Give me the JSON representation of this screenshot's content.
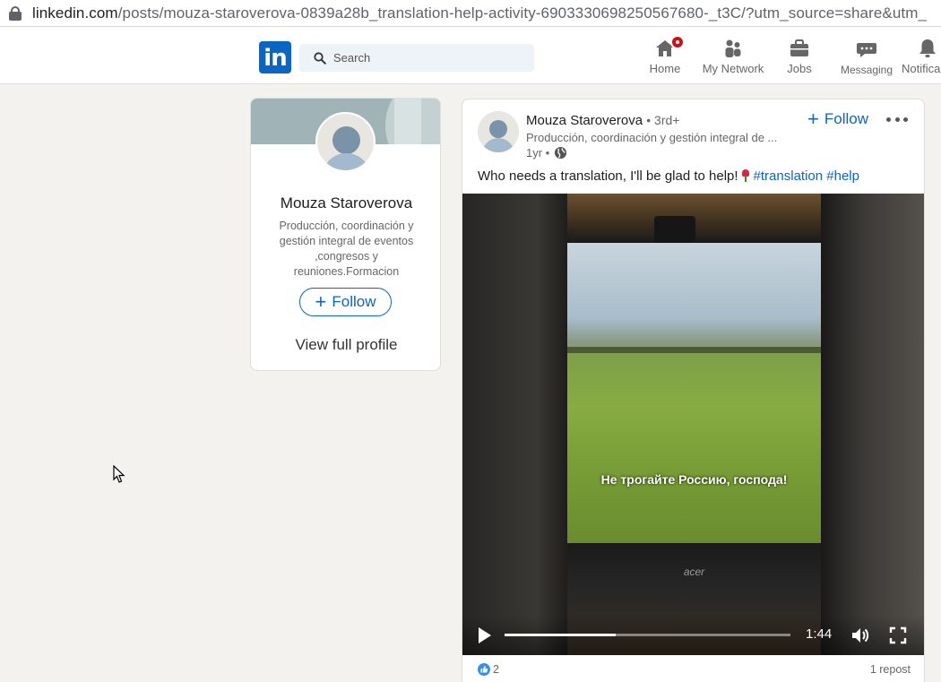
{
  "browser": {
    "url_host": "linkedin.com",
    "url_path": "/posts/mouza-staroverova-0839a28b_translation-help-activity-6903330698250567680-_t3C/?utm_source=share&utm_"
  },
  "nav": {
    "logo": "in",
    "search_placeholder": "Search",
    "items": [
      {
        "label": "Home",
        "icon": "home-icon"
      },
      {
        "label": "My Network",
        "icon": "network-icon"
      },
      {
        "label": "Jobs",
        "icon": "briefcase-icon"
      },
      {
        "label": "Messaging",
        "icon": "messaging-icon"
      },
      {
        "label": "Notifica",
        "icon": "bell-icon"
      }
    ]
  },
  "profile_card": {
    "name": "Mouza Staroverova",
    "headline": "Producción, coordinación y gestión integral de eventos ,congresos y reuniones.Formacion",
    "follow_label": "Follow",
    "view_profile_label": "View full profile"
  },
  "post": {
    "author": "Mouza Staroverova",
    "degree": "• 3rd+",
    "headline": "Producción, coordinación y gestión integral de ...",
    "time": "1yr •",
    "follow_label": "Follow",
    "text_before": "Who needs a translation, I'll be glad to help!",
    "hashtags": [
      "#translation",
      "#help"
    ],
    "video": {
      "subtitle": "Не трогайте Россию, господа!",
      "monitor_brand": "acer",
      "duration": "1:44",
      "progress": 0.39
    },
    "reactions_count": "2",
    "reposts": "1 repost"
  },
  "colors": {
    "brand": "#0a66c2",
    "background": "#f3f2ef",
    "badge": "#cc1016"
  }
}
